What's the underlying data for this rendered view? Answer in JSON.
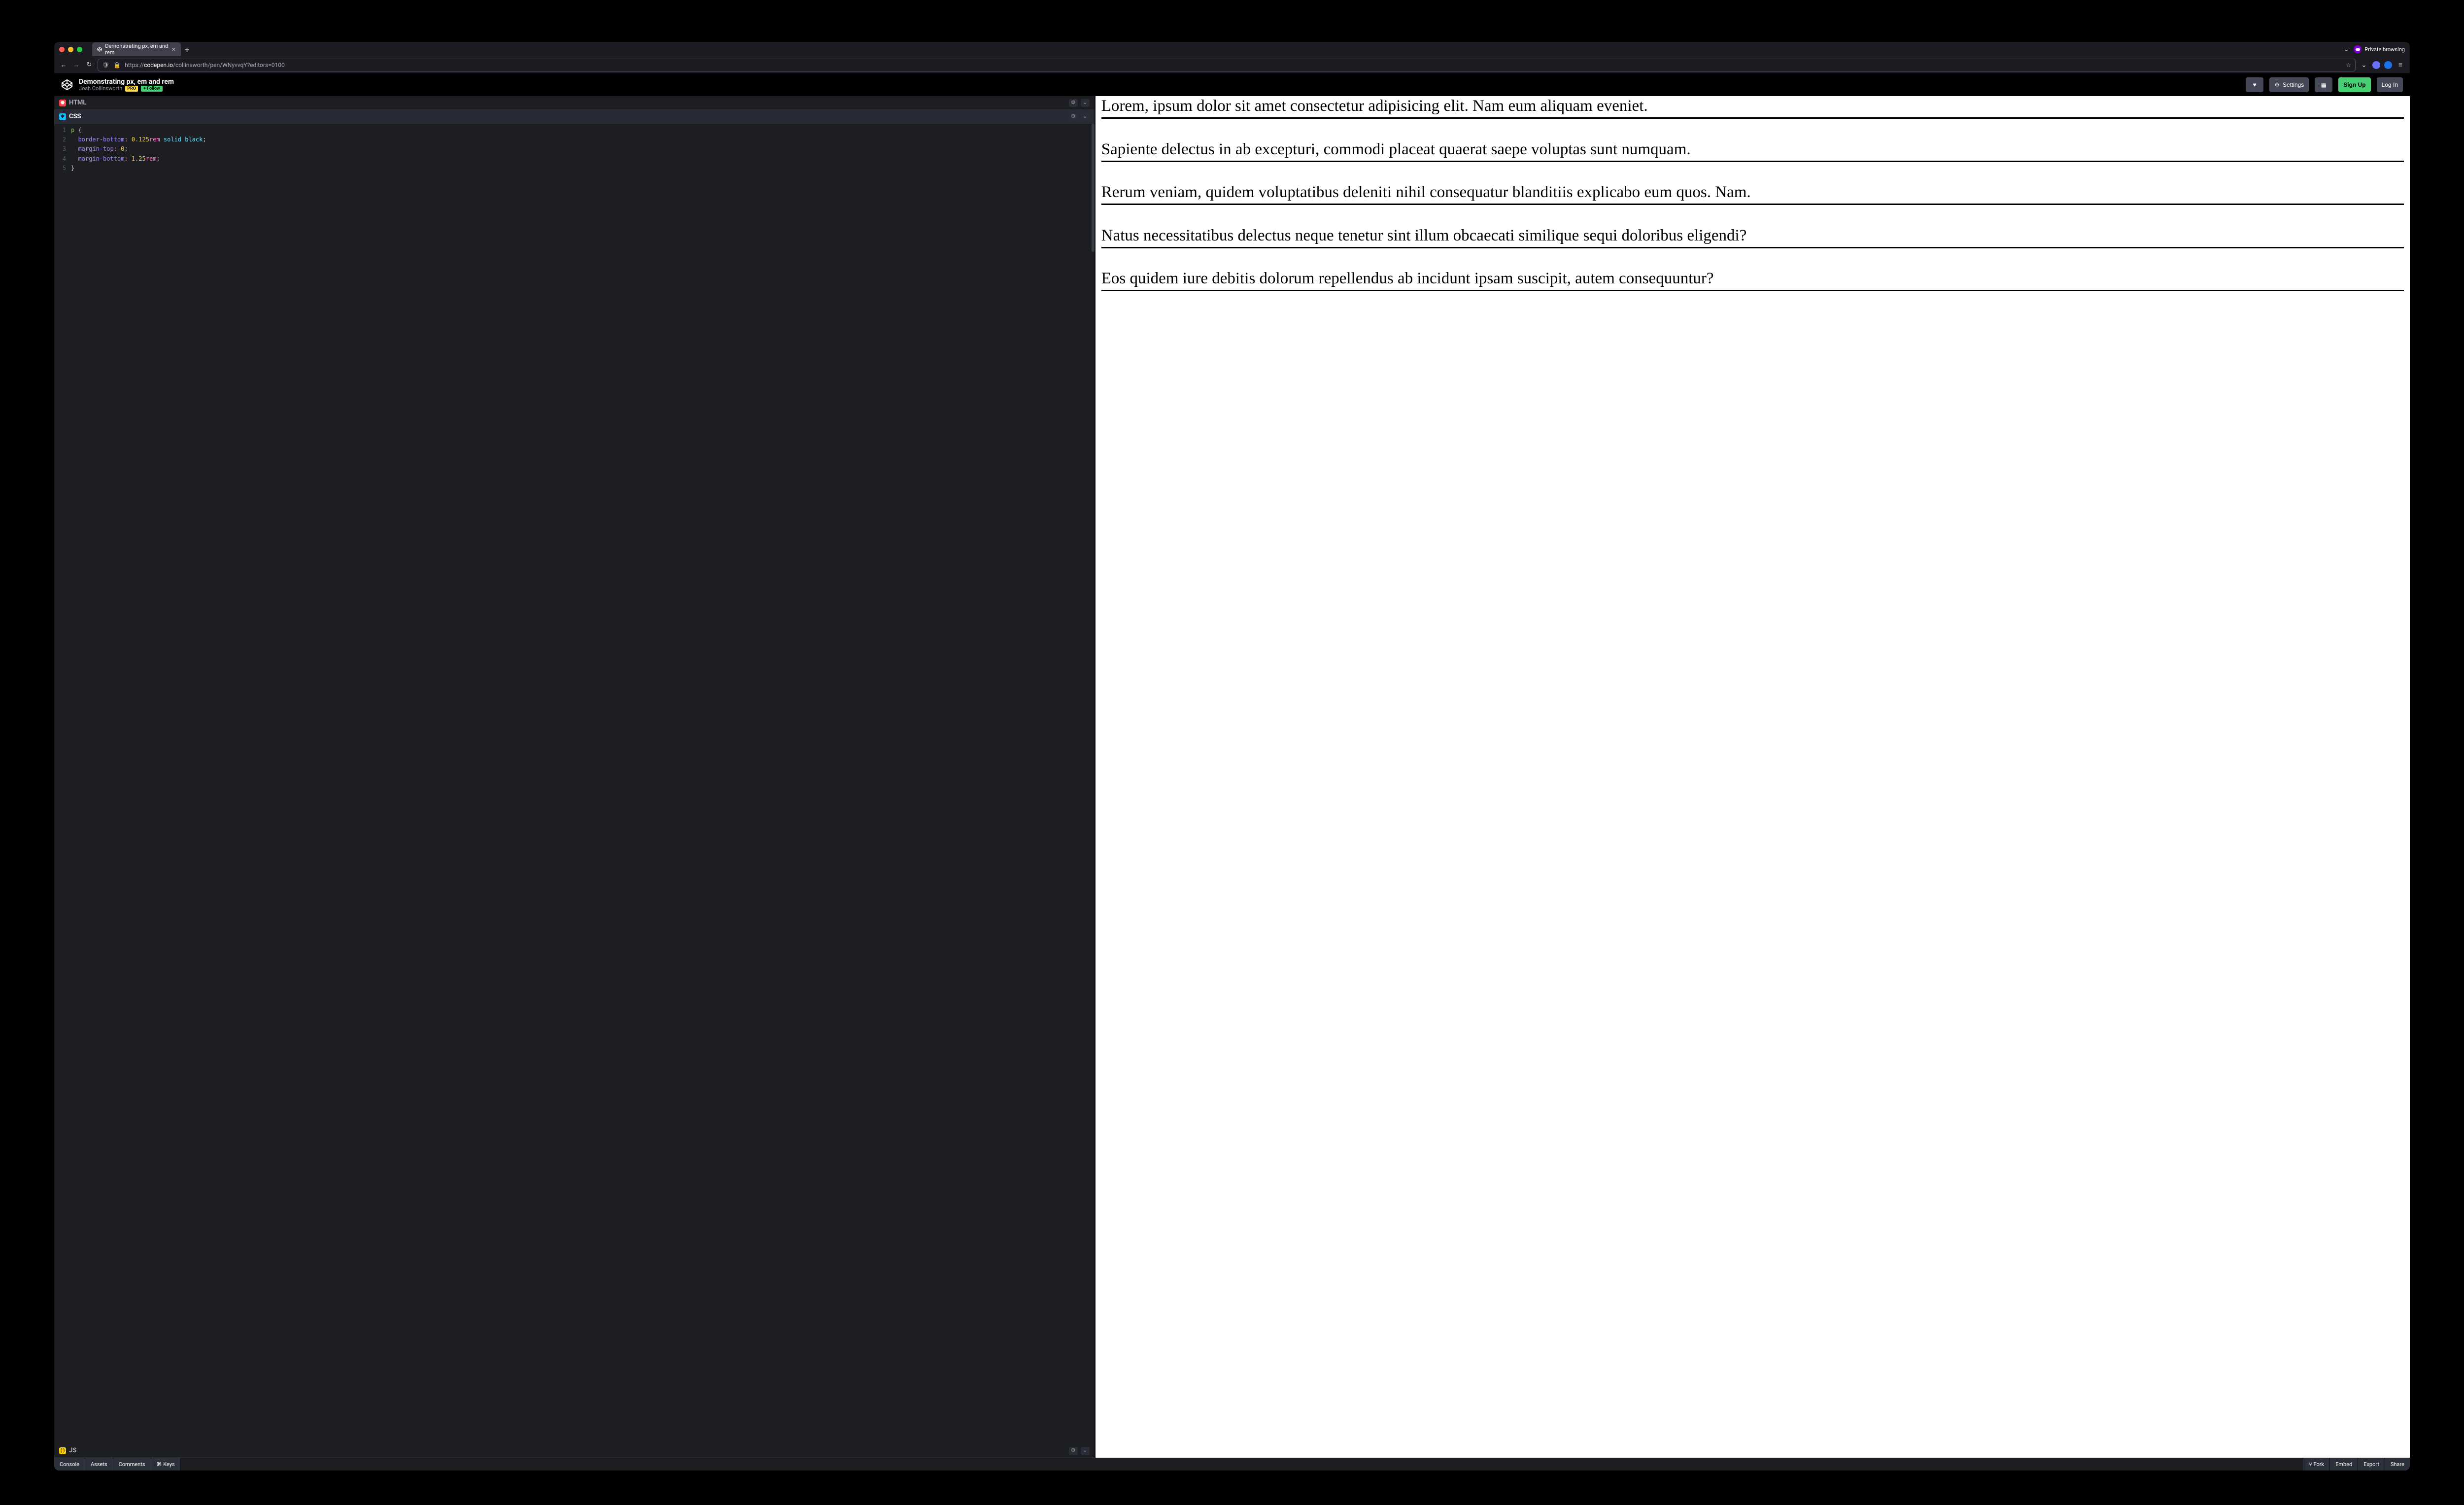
{
  "browser": {
    "tab_title": "Demonstrating px, em and rem",
    "priv_label": "Private browsing",
    "url_prefix": "https://",
    "url_host": "codepen.io",
    "url_path": "/collinsworth/pen/WNyvvqY?editors=0100"
  },
  "codepen": {
    "title": "Demonstrating px, em and rem",
    "author": "Josh Collinsworth",
    "pro": "PRO",
    "follow": "+ Follow",
    "settings": "Settings",
    "signup": "Sign Up",
    "login": "Log In"
  },
  "panels": {
    "html": "HTML",
    "css": "CSS",
    "js": "JS"
  },
  "css_code": {
    "l1": {
      "sel": "p",
      "open": " {"
    },
    "l2": {
      "prop": "border-bottom",
      "colon": ": ",
      "num": "0.125",
      "unit": "rem",
      "rest": " solid black",
      "semi": ";"
    },
    "l3": {
      "prop": "margin-top",
      "colon": ": ",
      "num": "0",
      "semi": ";"
    },
    "l4": {
      "prop": "margin-bottom",
      "colon": ": ",
      "num": "1.25",
      "unit": "rem",
      "semi": ";"
    },
    "l5": {
      "close": "}"
    }
  },
  "preview": {
    "p1": "Lorem, ipsum dolor sit amet consectetur adipisicing elit. Nam eum aliquam eveniet.",
    "p2": "Sapiente delectus in ab excepturi, commodi placeat quaerat saepe voluptas sunt numquam.",
    "p3": "Rerum veniam, quidem voluptatibus deleniti nihil consequatur blanditiis explicabo eum quos. Nam.",
    "p4": "Natus necessitatibus delectus neque tenetur sint illum obcaecati similique sequi doloribus eligendi?",
    "p5": "Eos quidem iure debitis dolorum repellendus ab incidunt ipsam suscipit, autem consequuntur?"
  },
  "footer": {
    "console": "Console",
    "assets": "Assets",
    "comments": "Comments",
    "keys": "⌘ Keys",
    "fork": "⑂ Fork",
    "embed": "Embed",
    "export": "Export",
    "share": "Share"
  },
  "gutter": {
    "n1": "1",
    "n2": "2",
    "n3": "3",
    "n4": "4",
    "n5": "5"
  }
}
